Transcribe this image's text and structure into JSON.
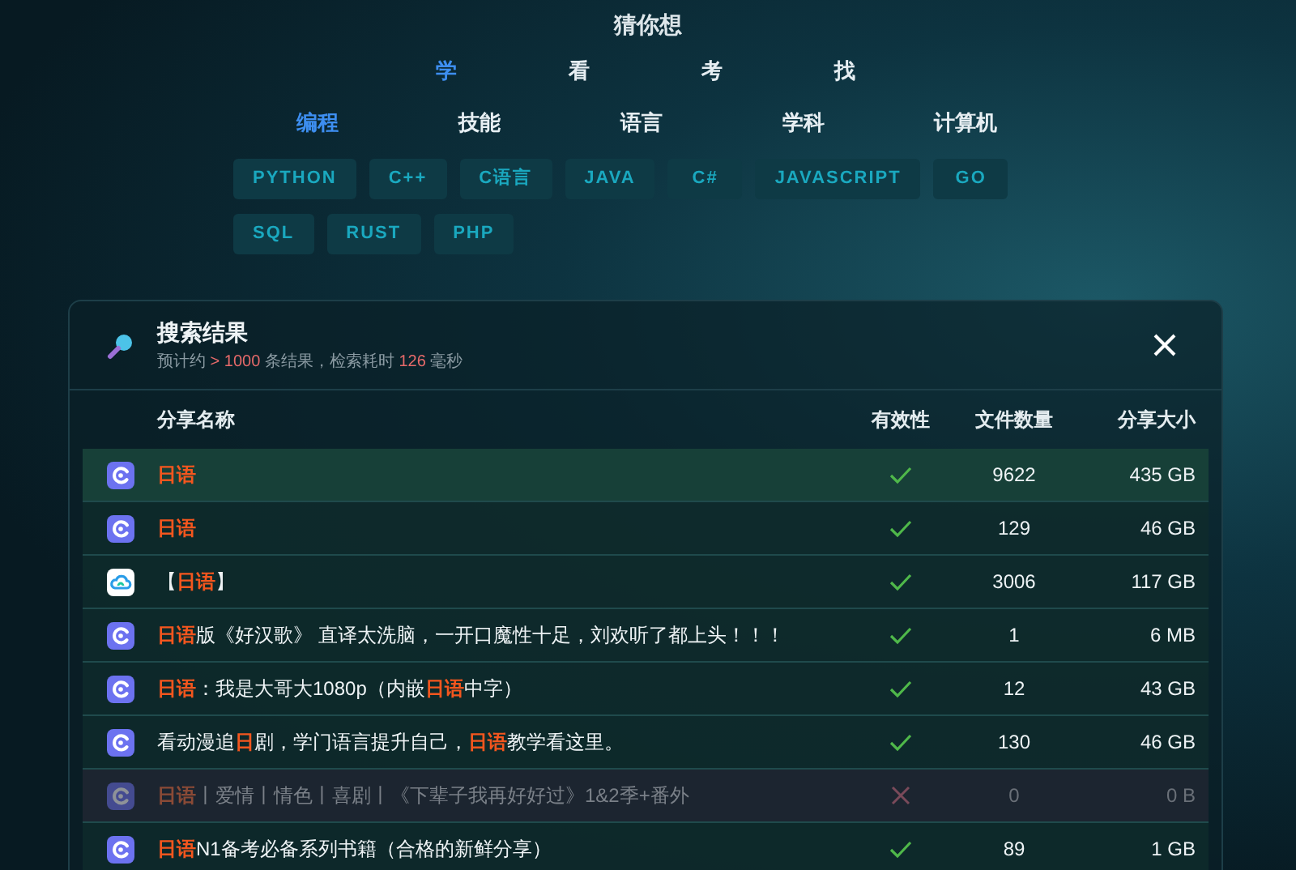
{
  "title": "猜你想",
  "modes": [
    {
      "label": "学",
      "selected": true
    },
    {
      "label": "看",
      "selected": false
    },
    {
      "label": "考",
      "selected": false
    },
    {
      "label": "找",
      "selected": false
    }
  ],
  "categories": [
    {
      "label": "编程",
      "selected": true
    },
    {
      "label": "技能",
      "selected": false
    },
    {
      "label": "语言",
      "selected": false
    },
    {
      "label": "学科",
      "selected": false
    },
    {
      "label": "计算机",
      "selected": false
    }
  ],
  "tags": [
    "PYTHON",
    "C++",
    "C语言",
    "JAVA",
    "C#",
    "JAVASCRIPT",
    "GO",
    "SQL",
    "RUST",
    "PHP"
  ],
  "results": {
    "title": "搜索结果",
    "summary": "预计约 **> 1000** 条结果，检索耗时 **126** 毫秒",
    "columns": [
      "分享名称",
      "有效性",
      "文件数量",
      "分享大小"
    ],
    "rows": [
      {
        "kind": "drive",
        "name": "**日语**",
        "valid": true,
        "files": "9622",
        "size": "435 GB"
      },
      {
        "kind": "drive",
        "name": "**日语**",
        "valid": true,
        "files": "129",
        "size": "46 GB"
      },
      {
        "kind": "cloud",
        "name": "【**日语**】",
        "valid": true,
        "files": "3006",
        "size": "117 GB"
      },
      {
        "kind": "drive",
        "name": "**日语**版《好汉歌》 直译太洗脑，一开口魔性十足，刘欢听了都上头！！！",
        "valid": true,
        "files": "1",
        "size": "6 MB"
      },
      {
        "kind": "drive",
        "name": "**日语**：我是大哥大1080p（内嵌**日语**中字）",
        "valid": true,
        "files": "12",
        "size": "43 GB"
      },
      {
        "kind": "drive",
        "name": "看动漫追**日**剧，学门语言提升自己，**日语**教学看这里。",
        "valid": true,
        "files": "130",
        "size": "46 GB"
      },
      {
        "kind": "drive",
        "name": "**日语**丨爱情丨情色丨喜剧丨《下辈子我再好好过》1&2季+番外",
        "valid": false,
        "files": "0",
        "size": "0 B"
      },
      {
        "kind": "drive",
        "name": "**日语**N1备考必备系列书籍（合格的新鲜分享）",
        "valid": true,
        "files": "89",
        "size": "1 GB"
      }
    ]
  }
}
